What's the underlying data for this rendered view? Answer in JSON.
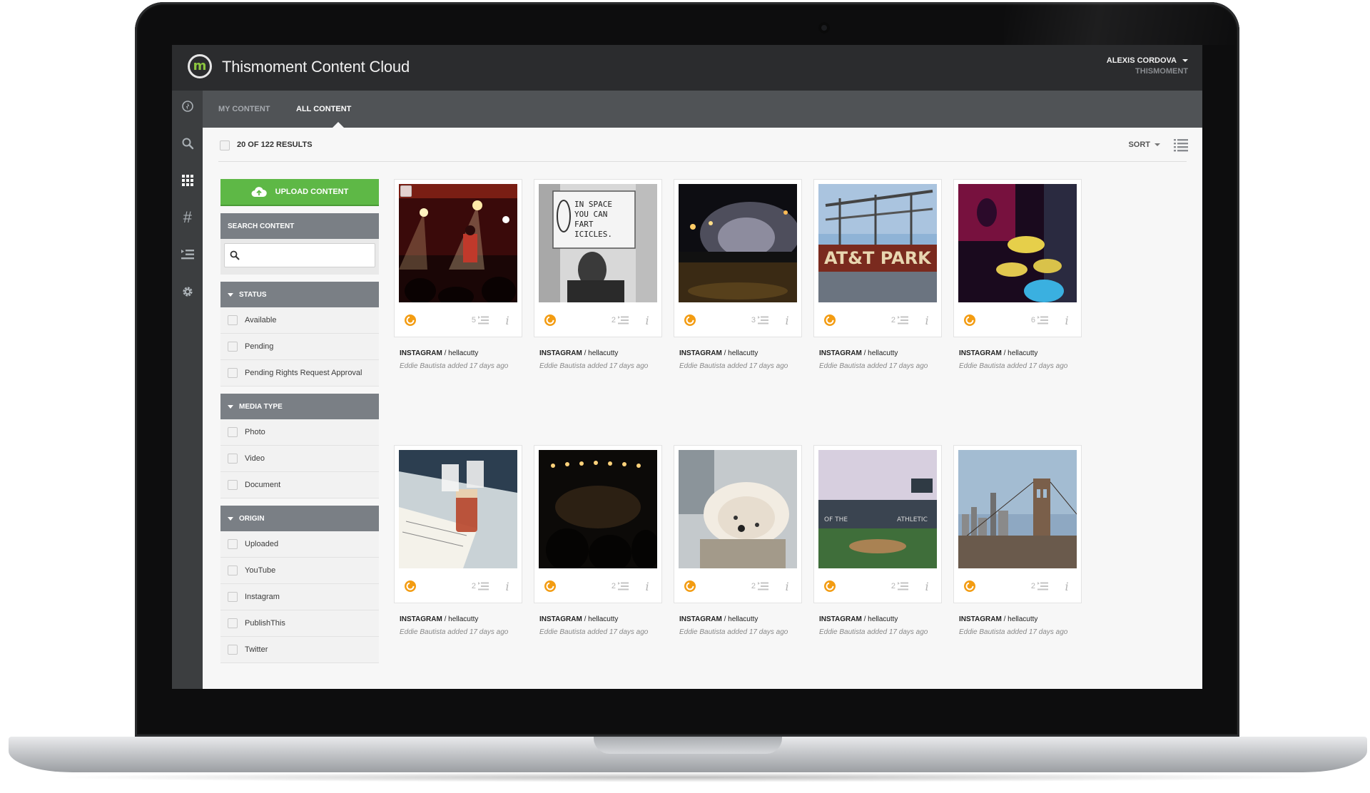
{
  "app": {
    "title": "Thismoment Content Cloud",
    "logo_letter": "m",
    "user_name": "ALEXIS CORDOVA",
    "user_org": "THISMOMENT"
  },
  "tabs": [
    {
      "label": "MY CONTENT",
      "active": false
    },
    {
      "label": "ALL CONTENT",
      "active": true
    }
  ],
  "results": {
    "label": "20 OF 122 RESULTS",
    "sort_label": "SORT"
  },
  "left_rail_icons": [
    "compass-icon",
    "search-icon",
    "grid-icon",
    "hashtag-icon",
    "list-icon",
    "gear-icon"
  ],
  "sidebar": {
    "upload_label": "UPLOAD CONTENT",
    "search_header": "SEARCH CONTENT",
    "search_value": "",
    "sections": [
      {
        "title": "STATUS",
        "options": [
          "Available",
          "Pending",
          "Pending Rights Request Approval"
        ]
      },
      {
        "title": "MEDIA TYPE",
        "options": [
          "Photo",
          "Video",
          "Document"
        ]
      },
      {
        "title": "ORIGIN",
        "options": [
          "Uploaded",
          "YouTube",
          "Instagram",
          "PublishThis",
          "Twitter"
        ]
      }
    ]
  },
  "colors": {
    "accent_green": "#5eb846",
    "rights_orange": "#f39c12",
    "header_dark": "#2b2c2e"
  },
  "cards": [
    {
      "source": "INSTAGRAM",
      "user": "hellacutty",
      "added": "Eddie Bautista added 17 days ago",
      "count": "5",
      "scene": "concert-red-lights"
    },
    {
      "source": "INSTAGRAM",
      "user": "hellacutty",
      "added": "Eddie Bautista added 17 days ago",
      "count": "2",
      "scene": "sign-holder"
    },
    {
      "source": "INSTAGRAM",
      "user": "hellacutty",
      "added": "Eddie Bautista added 17 days ago",
      "count": "3",
      "scene": "night-street-crowd"
    },
    {
      "source": "INSTAGRAM",
      "user": "hellacutty",
      "added": "Eddie Bautista added 17 days ago",
      "count": "2",
      "scene": "ballpark-sign"
    },
    {
      "source": "INSTAGRAM",
      "user": "hellacutty",
      "added": "Eddie Bautista added 17 days ago",
      "count": "6",
      "scene": "drum-kit"
    },
    {
      "source": "INSTAGRAM",
      "user": "hellacutty",
      "added": "Eddie Bautista added 17 days ago",
      "count": "2",
      "scene": "beer-notebook"
    },
    {
      "source": "INSTAGRAM",
      "user": "hellacutty",
      "added": "Eddie Bautista added 17 days ago",
      "count": "2",
      "scene": "concert-crowd-dark"
    },
    {
      "source": "INSTAGRAM",
      "user": "hellacutty",
      "added": "Eddie Bautista added 17 days ago",
      "count": "2",
      "scene": "fluffy-dog"
    },
    {
      "source": "INSTAGRAM",
      "user": "hellacutty",
      "added": "Eddie Bautista added 17 days ago",
      "count": "2",
      "scene": "baseball-stadium"
    },
    {
      "source": "INSTAGRAM",
      "user": "hellacutty",
      "added": "Eddie Bautista added 17 days ago",
      "count": "2",
      "scene": "bridge-skyline"
    }
  ]
}
